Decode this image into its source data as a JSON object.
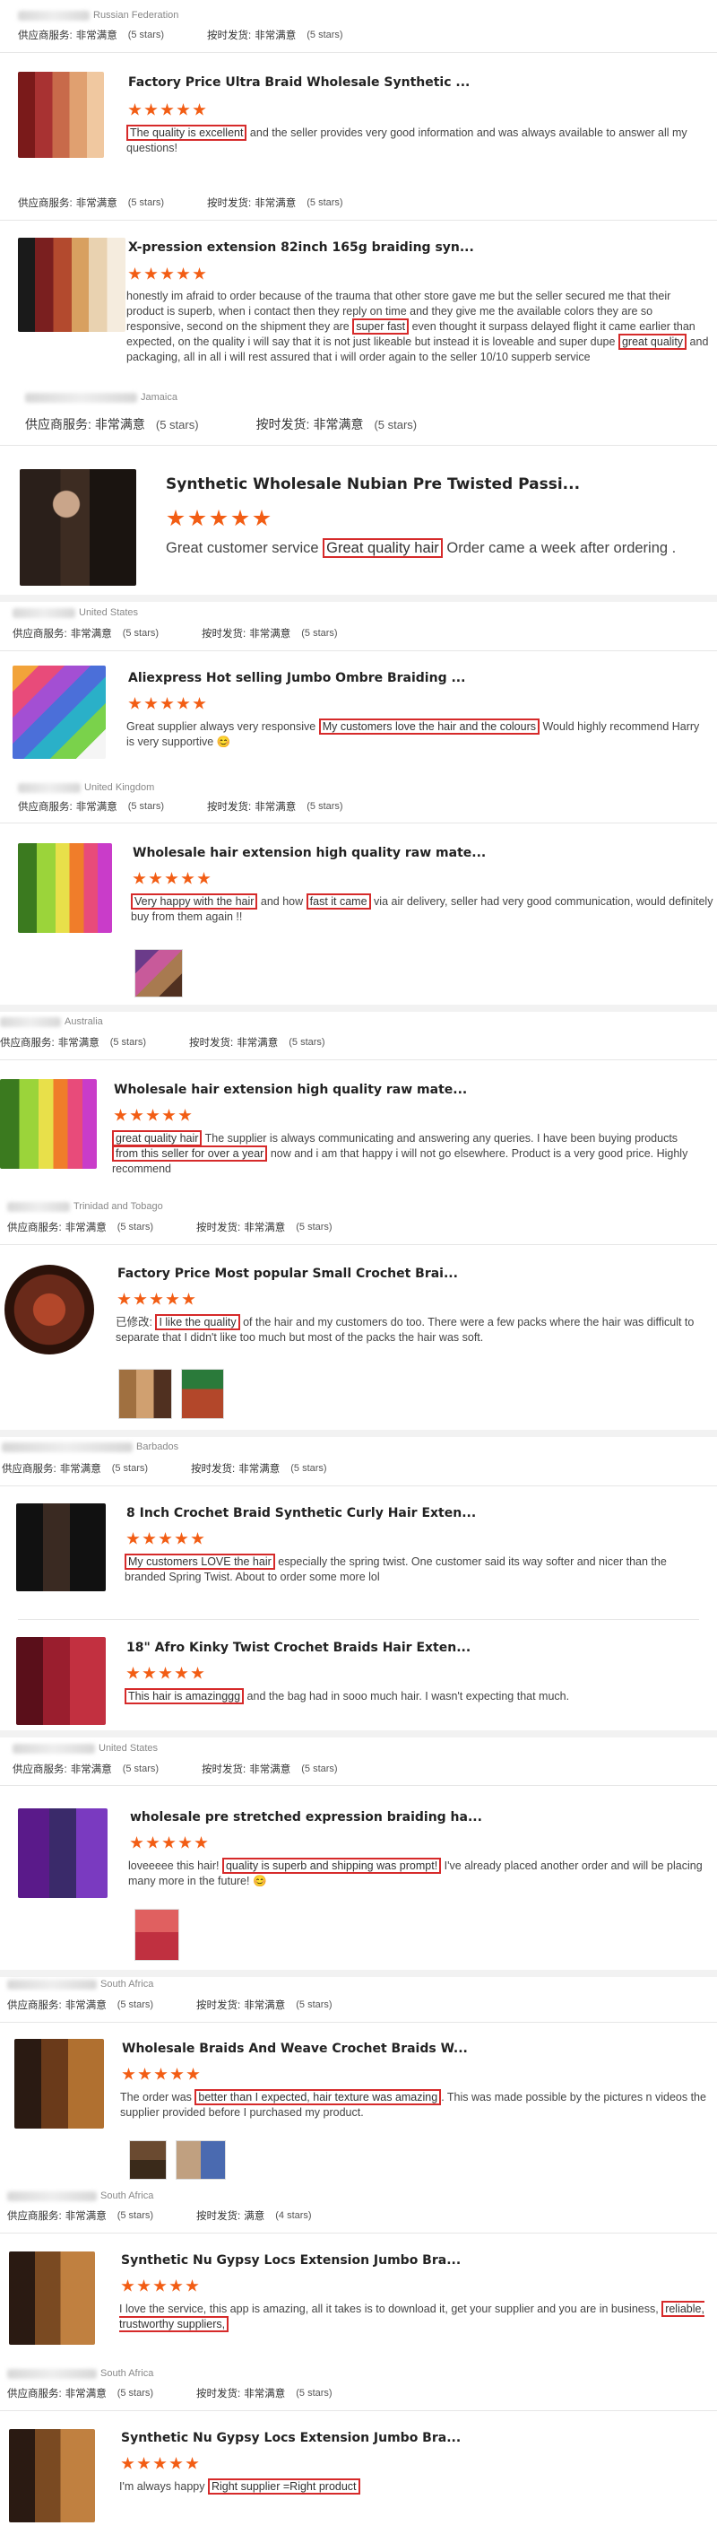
{
  "labels": {
    "supplier_service": "供应商服务:",
    "shipping": "按时发货:",
    "very_satisfied": "非常满意",
    "satisfied": "满意",
    "five_stars": "(5 stars)",
    "four_stars": "(4 stars)",
    "edited": "已修改:"
  },
  "reviews": [
    {
      "country": "Russian Federation",
      "title": "Factory Price Ultra Braid Wholesale Synthetic ...",
      "parts": [
        {
          "h": true,
          "t": "The quality is excellent"
        },
        {
          "h": false,
          "t": " and the seller provides very good information and was always available to answer all my questions!"
        }
      ]
    },
    {
      "country": "",
      "title": "X-pression extension 82inch 165g braiding syn...",
      "parts": [
        {
          "h": false,
          "t": "honestly im afraid to order because of the trauma that other store gave me but the seller secured me that their product is superb, when i contact then they reply on time and they give me the available colors they are so responsive, second on the shipment they are "
        },
        {
          "h": true,
          "t": "super fast"
        },
        {
          "h": false,
          "t": " even thought it surpass delayed flight it came earlier than expected, on the quality i will say that it is not just likeable but instead it is loveable and super dupe "
        },
        {
          "h": true,
          "t": "great quality"
        },
        {
          "h": false,
          "t": " and packaging, all in all i will rest assured that i will order again to the seller 10/10 supperb service"
        }
      ]
    },
    {
      "country": "Jamaica",
      "title": "Synthetic Wholesale Nubian Pre Twisted Passi...",
      "parts": [
        {
          "h": false,
          "t": "Great customer service "
        },
        {
          "h": true,
          "t": "Great quality hair"
        },
        {
          "h": false,
          "t": " Order came a week after ordering ."
        }
      ]
    },
    {
      "country": "United States",
      "title": "Aliexpress Hot selling Jumbo Ombre Braiding ...",
      "parts": [
        {
          "h": false,
          "t": "Great supplier always very responsive "
        },
        {
          "h": true,
          "t": "My customers love the hair and the colours"
        },
        {
          "h": false,
          "t": " Would highly recommend Harry is very supportive 😊"
        }
      ]
    },
    {
      "country": "United Kingdom",
      "title": "Wholesale hair extension high quality raw mate...",
      "parts": [
        {
          "h": true,
          "t": "Very happy with the hair"
        },
        {
          "h": false,
          "t": " and how "
        },
        {
          "h": true,
          "t": "fast it came"
        },
        {
          "h": false,
          "t": " via air delivery, seller had very good communication, would definitely buy from them again !!"
        }
      ]
    },
    {
      "country": "Australia",
      "title": "Wholesale hair extension high quality raw mate...",
      "parts": [
        {
          "h": true,
          "t": "great quality hair"
        },
        {
          "h": false,
          "t": " The supplier is always communicating and answering any queries. I have been buying products "
        },
        {
          "h": true,
          "t": "from this seller for over a year"
        },
        {
          "h": false,
          "t": " now and i am that happy i will not go elsewhere. Product is a very good price.  Highly recommend"
        }
      ]
    },
    {
      "country": "Trinidad and Tobago",
      "title": "Factory Price Most popular Small Crochet Brai...",
      "parts": [
        {
          "h": false,
          "t": "已修改: "
        },
        {
          "h": true,
          "t": "I like the quality"
        },
        {
          "h": false,
          "t": " of the hair and my customers do too. There were a few packs where the hair was difficult to separate that I didn't like too much but most of the packs the hair was soft."
        }
      ]
    },
    {
      "country": "Barbados",
      "title": "8 Inch Crochet Braid Synthetic Curly Hair Exten...",
      "parts": [
        {
          "h": true,
          "t": "My customers LOVE the hair"
        },
        {
          "h": false,
          "t": " especially the spring twist. One customer said its way softer and nicer than the branded Spring Twist. About to order some more lol"
        }
      ]
    },
    {
      "country": "",
      "title": "18\" Afro Kinky Twist Crochet Braids Hair Exten...",
      "parts": [
        {
          "h": true,
          "t": "This hair is amazinggg"
        },
        {
          "h": false,
          "t": " and the bag had in sooo much hair. I wasn't expecting that much."
        }
      ]
    },
    {
      "country": "United States",
      "title": "wholesale pre stretched expression braiding ha...",
      "parts": [
        {
          "h": false,
          "t": "loveeeee this hair! "
        },
        {
          "h": true,
          "t": "quality is superb and shipping was prompt!"
        },
        {
          "h": false,
          "t": " I've already placed another order and will be placing many more in the future! 😊"
        }
      ]
    },
    {
      "country": "South Africa",
      "title": "Wholesale Braids And Weave Crochet Braids W...",
      "parts": [
        {
          "h": false,
          "t": "The order was "
        },
        {
          "h": true,
          "t": "better than I expected, hair texture was amazing"
        },
        {
          "h": false,
          "t": ". This was made possible by the pictures n videos the supplier provided before I purchased my product."
        }
      ]
    },
    {
      "country": "South Africa",
      "title": "Synthetic Nu Gypsy Locs Extension Jumbo Bra...",
      "parts": [
        {
          "h": false,
          "t": "I love the service, this app is amazing, all it takes is to download it, get your supplier and you are in business, "
        },
        {
          "h": true,
          "t": "reliable, trustworthy suppliers,"
        }
      ]
    },
    {
      "country": "South Africa",
      "title": "Synthetic Nu Gypsy Locs Extension Jumbo Bra...",
      "parts": [
        {
          "h": false,
          "t": "I'm always happy "
        },
        {
          "h": true,
          "t": "Right supplier =Right product"
        }
      ]
    }
  ]
}
